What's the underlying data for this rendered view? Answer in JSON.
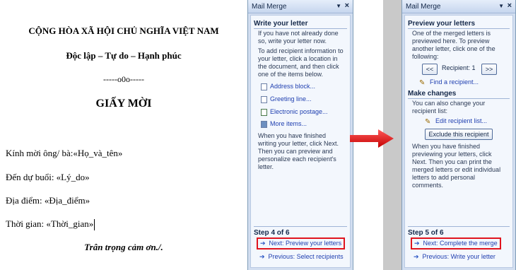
{
  "document": {
    "heading": "CỘNG HÒA XÃ HỘI CHỦ NGHĨA VIỆT NAM",
    "subheading": "Độc lập – Tự do – Hạnh phúc",
    "divider": "-----o0o-----",
    "title": "GIẤY MỜI",
    "lines": [
      "Kính mời ông/ bà:«Họ_và_tên»",
      "Đến dự buổi: «Lý_do»",
      "Địa điểm: «Địa_điểm»",
      "Thời gian: «Thời_gian»"
    ],
    "closing": "Trân trọng cảm ơn./."
  },
  "pane_left": {
    "title": "Mail Merge",
    "section": "Write your letter",
    "intro": "If you have not already done so, write your letter now.",
    "instructions": "To add recipient information to your letter, click a location in the document, and then click one of the items below.",
    "links": [
      {
        "label": "Address block...",
        "icon": "address-block-icon"
      },
      {
        "label": "Greeting line...",
        "icon": "greeting-line-icon"
      },
      {
        "label": "Electronic postage...",
        "icon": "postage-icon"
      },
      {
        "label": "More items...",
        "icon": "more-items-icon"
      }
    ],
    "finish_text": "When you have finished writing your letter, click Next. Then you can preview and personalize each recipient's letter.",
    "step": "Step 4 of 6",
    "next": "Next: Preview your letters",
    "previous": "Previous: Select recipients"
  },
  "pane_right": {
    "title": "Mail Merge",
    "section1": "Preview your letters",
    "preview_text": "One of the merged letters is previewed here. To preview another letter, click one of the following:",
    "prev_btn": "<<",
    "recipient": "Recipient: 1",
    "next_btn": ">>",
    "find": "Find a recipient...",
    "section2": "Make changes",
    "changes_text": "You can also change your recipient list:",
    "edit": "Edit recipient list...",
    "exclude": "Exclude this recipient",
    "finish_text": "When you have finished previewing your letters, click Next. Then you can print the merged letters or edit individual letters to add personal comments.",
    "step": "Step 5 of 6",
    "next": "Next: Complete the merge",
    "previous": "Previous: Write your letter"
  },
  "colors": {
    "highlight": "#e0141e",
    "link": "#1f3fb0",
    "pane": "#d2def0"
  }
}
